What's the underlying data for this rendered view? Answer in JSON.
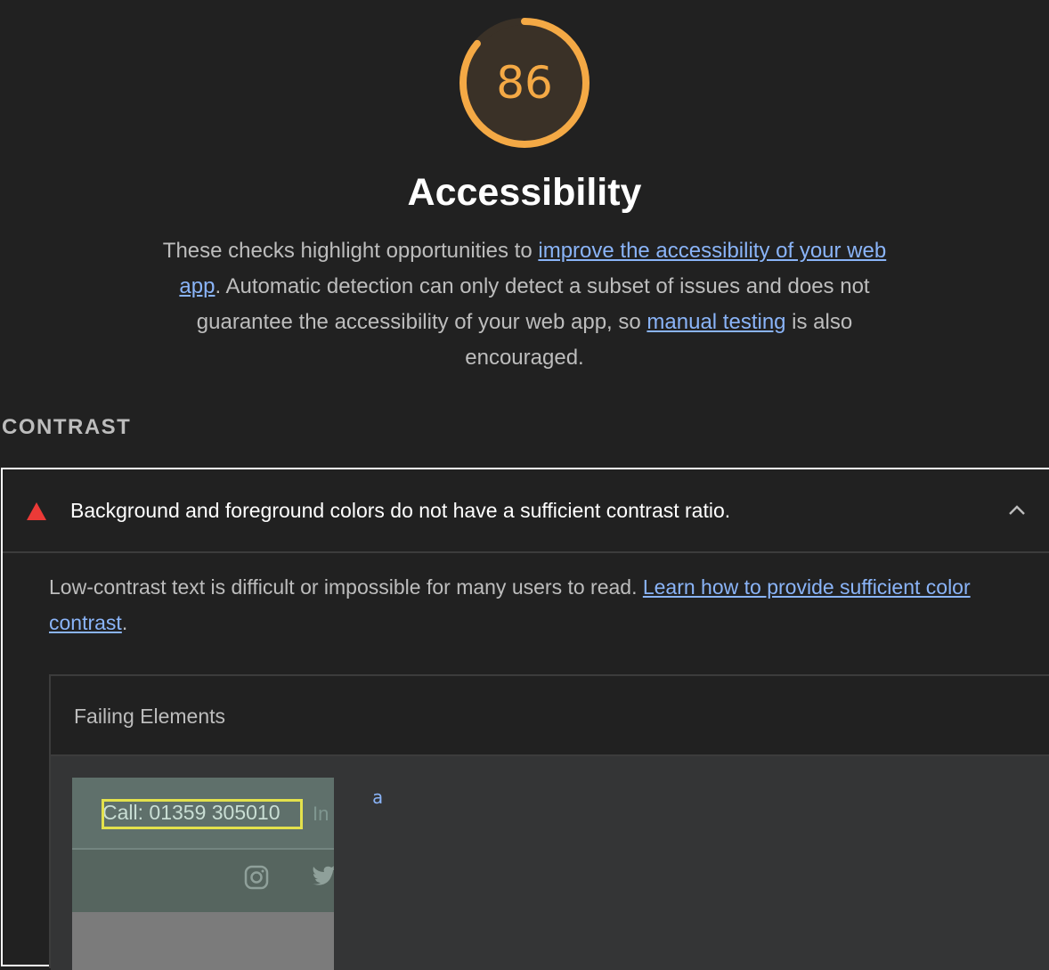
{
  "gauge": {
    "score": "86",
    "score_fraction": 0.86,
    "color": "#f4a945"
  },
  "category": {
    "title": "Accessibility",
    "desc_part1": "These checks highlight opportunities to ",
    "desc_link1": "improve the accessibility of your web app",
    "desc_part2": ". Automatic detection can only detect a subset of issues and does not guarantee the accessibility of your web app, so ",
    "desc_link2": "manual testing",
    "desc_part3": " is also encouraged."
  },
  "group": {
    "title": "CONTRAST"
  },
  "audit": {
    "status_icon": "fail-triangle-icon",
    "status_color": "#ec3a37",
    "title": "Background and foreground colors do not have a sufficient contrast ratio.",
    "expand_icon": "chevron-up-icon",
    "desc_part1": "Low-contrast text is difficult or impossible for many users to read. ",
    "desc_link": "Learn how to provide sufficient color contrast",
    "desc_part2": "."
  },
  "details": {
    "column_header": "Failing Elements",
    "rows": [
      {
        "thumbnail_text": "Call: 01359 305010",
        "thumbnail_faint_text": "In",
        "node_label": "a"
      }
    ]
  },
  "colors": {
    "background": "#212121",
    "link": "#8ab4f8",
    "warning": "#f4a945",
    "fail": "#ec3a37"
  }
}
